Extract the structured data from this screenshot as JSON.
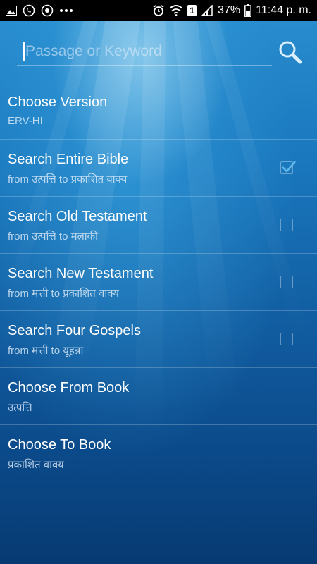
{
  "status_bar": {
    "battery_percent": "37%",
    "time": "11:44 p. m.",
    "sim_badge": "1",
    "icons_left": [
      "gallery-icon",
      "whatsapp-icon",
      "chrome-icon",
      "more-icon"
    ],
    "icons_right": [
      "alarm-icon",
      "wifi-icon",
      "sim-icon",
      "signal-icon",
      "battery-icon"
    ]
  },
  "search": {
    "placeholder": "Passage or Keyword",
    "value": ""
  },
  "options": [
    {
      "title": "Choose Version",
      "subtitle": "ERV-HI",
      "checkbox": false
    },
    {
      "title": "Search Entire Bible",
      "subtitle": "from उत्पत्ति to प्रकाशित वाक्य",
      "checkbox": true,
      "checked": true
    },
    {
      "title": "Search Old Testament",
      "subtitle": "from उत्पत्ति to मलाकी",
      "checkbox": true,
      "checked": false
    },
    {
      "title": "Search New Testament",
      "subtitle": "from मत्ती to प्रकाशित वाक्य",
      "checkbox": true,
      "checked": false
    },
    {
      "title": "Search Four Gospels",
      "subtitle": "from मत्ती to यूहन्ना",
      "checkbox": true,
      "checked": false
    },
    {
      "title": "Choose From Book",
      "subtitle": "उत्पत्ति",
      "checkbox": false
    },
    {
      "title": "Choose To Book",
      "subtitle": "प्रकाशित वाक्य",
      "checkbox": false
    }
  ],
  "colors": {
    "accent_check": "#5fb8e8",
    "background_top": "#2a8fd0",
    "background_bottom": "#073a72"
  }
}
